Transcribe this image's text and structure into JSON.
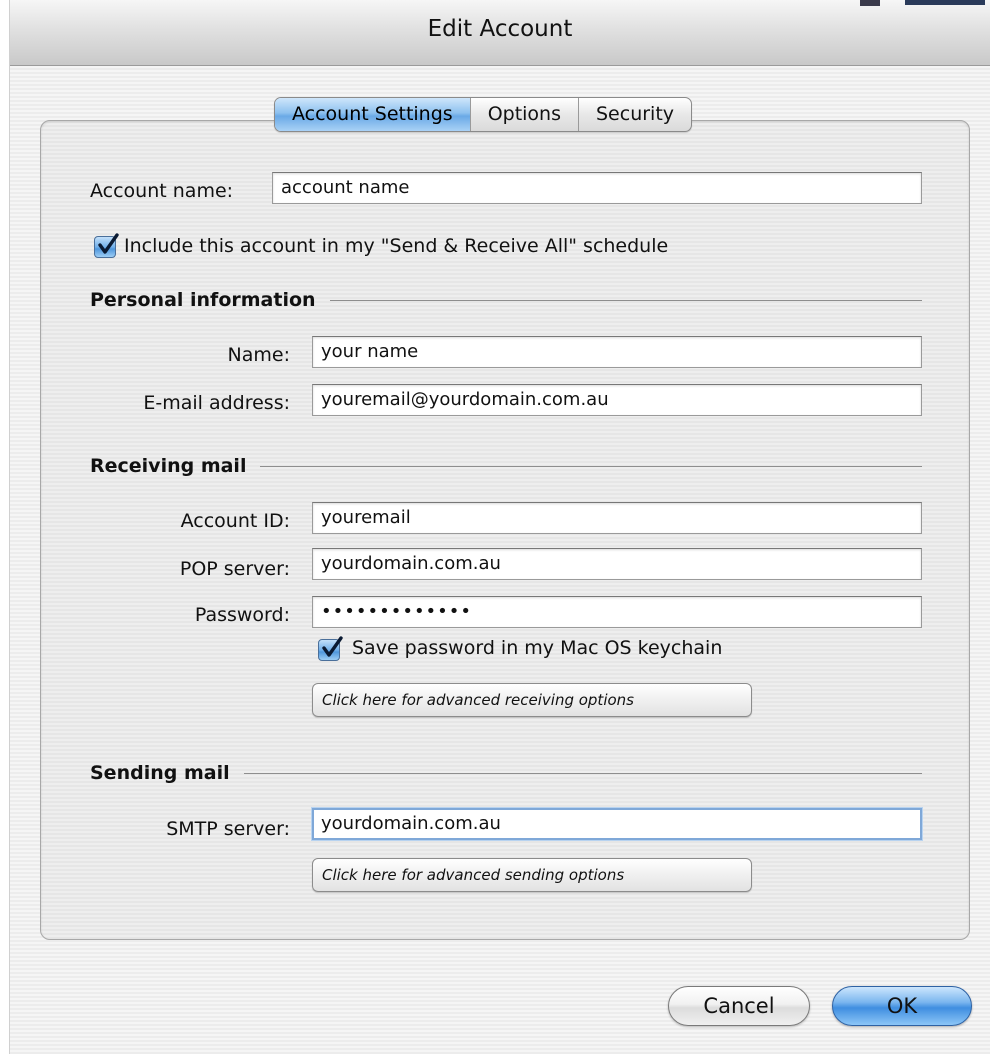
{
  "window": {
    "title": "Edit Account"
  },
  "tabs": [
    {
      "label": "Account Settings",
      "active": true
    },
    {
      "label": "Options",
      "active": false
    },
    {
      "label": "Security",
      "active": false
    }
  ],
  "account": {
    "name_label": "Account name:",
    "name_value": "account name",
    "include_checked": true,
    "include_label": "Include this account in my \"Send & Receive All\" schedule"
  },
  "personal": {
    "heading": "Personal information",
    "name_label": "Name:",
    "name_value": "your name",
    "email_label": "E-mail address:",
    "email_value": "youremail@yourdomain.com.au"
  },
  "receiving": {
    "heading": "Receiving mail",
    "account_id_label": "Account ID:",
    "account_id_value": "youremail",
    "pop_label": "POP server:",
    "pop_value": "yourdomain.com.au",
    "password_label": "Password:",
    "password_value": "•••••••••••••",
    "save_pw_checked": true,
    "save_pw_label": "Save password in my Mac OS keychain",
    "advanced_label": "Click here for advanced receiving options"
  },
  "sending": {
    "heading": "Sending mail",
    "smtp_label": "SMTP server:",
    "smtp_value": "yourdomain.com.au",
    "advanced_label": "Click here for advanced sending options"
  },
  "buttons": {
    "cancel": "Cancel",
    "ok": "OK"
  },
  "colors": {
    "accent": "#6aa9e6",
    "ok_button": "#3f8ee0"
  }
}
